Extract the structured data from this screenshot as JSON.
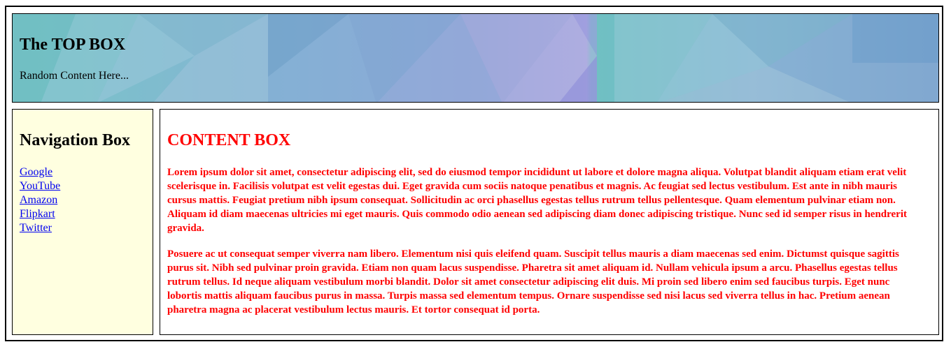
{
  "top_box": {
    "title": "The TOP BOX",
    "text": "Random Content Here..."
  },
  "nav_box": {
    "title": "Navigation Box",
    "background_color": "#ffffe0",
    "links": [
      "Google",
      "YouTube",
      "Amazon",
      "Flipkart",
      "Twitter"
    ]
  },
  "content_box": {
    "title": "CONTENT BOX",
    "text_color": "#ff0000",
    "paragraphs": [
      "Lorem ipsum dolor sit amet, consectetur adipiscing elit, sed do eiusmod tempor incididunt ut labore et dolore magna aliqua. Volutpat blandit aliquam etiam erat velit scelerisque in. Facilisis volutpat est velit egestas dui. Eget gravida cum sociis natoque penatibus et magnis. Ac feugiat sed lectus vestibulum. Est ante in nibh mauris cursus mattis. Feugiat pretium nibh ipsum consequat. Sollicitudin ac orci phasellus egestas tellus rutrum tellus pellentesque. Quam elementum pulvinar etiam non. Aliquam id diam maecenas ultricies mi eget mauris. Quis commodo odio aenean sed adipiscing diam donec adipiscing tristique. Nunc sed id semper risus in hendrerit gravida.",
      "Posuere ac ut consequat semper viverra nam libero. Elementum nisi quis eleifend quam. Suscipit tellus mauris a diam maecenas sed enim. Dictumst quisque sagittis purus sit. Nibh sed pulvinar proin gravida. Etiam non quam lacus suspendisse. Pharetra sit amet aliquam id. Nullam vehicula ipsum a arcu. Phasellus egestas tellus rutrum tellus. Id neque aliquam vestibulum morbi blandit. Dolor sit amet consectetur adipiscing elit duis. Mi proin sed libero enim sed faucibus turpis. Eget nunc lobortis mattis aliquam faucibus purus in massa. Turpis massa sed elementum tempus. Ornare suspendisse sed nisi lacus sed viverra tellus in hac. Pretium aenean pharetra magna ac placerat vestibulum lectus mauris. Et tortor consequat id porta."
    ]
  }
}
